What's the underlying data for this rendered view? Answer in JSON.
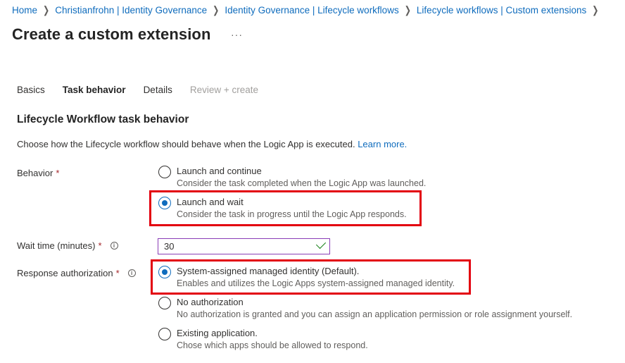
{
  "breadcrumb": [
    "Home",
    "Christianfrohn | Identity Governance",
    "Identity Governance | Lifecycle workflows",
    "Lifecycle workflows | Custom extensions"
  ],
  "page": {
    "title": "Create a custom extension",
    "more_label": "···"
  },
  "tabs": [
    {
      "label": "Basics"
    },
    {
      "label": "Task behavior"
    },
    {
      "label": "Details"
    },
    {
      "label": "Review + create"
    }
  ],
  "section": {
    "title": "Lifecycle Workflow task behavior",
    "description": "Choose how the Lifecycle workflow should behave when the Logic App is executed.",
    "learn_more": "Learn more."
  },
  "behavior": {
    "label": "Behavior",
    "required": "*",
    "options": [
      {
        "label": "Launch and continue",
        "desc": "Consider the task completed when the Logic App was launched.",
        "selected": false
      },
      {
        "label": "Launch and wait",
        "desc": "Consider the task in progress until the Logic App responds.",
        "selected": true
      }
    ]
  },
  "wait_time": {
    "label": "Wait time (minutes)",
    "required": "*",
    "info_icon": "i",
    "value": "30"
  },
  "response_auth": {
    "label": "Response authorization",
    "required": "*",
    "info_icon": "i",
    "options": [
      {
        "label": "System-assigned managed identity (Default).",
        "desc": "Enables and utilizes the Logic Apps system-assigned managed identity.",
        "selected": true
      },
      {
        "label": "No authorization",
        "desc": "No authorization is granted and you can assign an application permission or role assignment yourself.",
        "selected": false
      },
      {
        "label": "Existing application.",
        "desc": "Chose which apps should be allowed to respond.",
        "selected": false
      }
    ]
  },
  "colors": {
    "accent": "#0f6cbd",
    "highlight": "#e3000f",
    "required": "#a4262c",
    "valid": "#107c10"
  }
}
